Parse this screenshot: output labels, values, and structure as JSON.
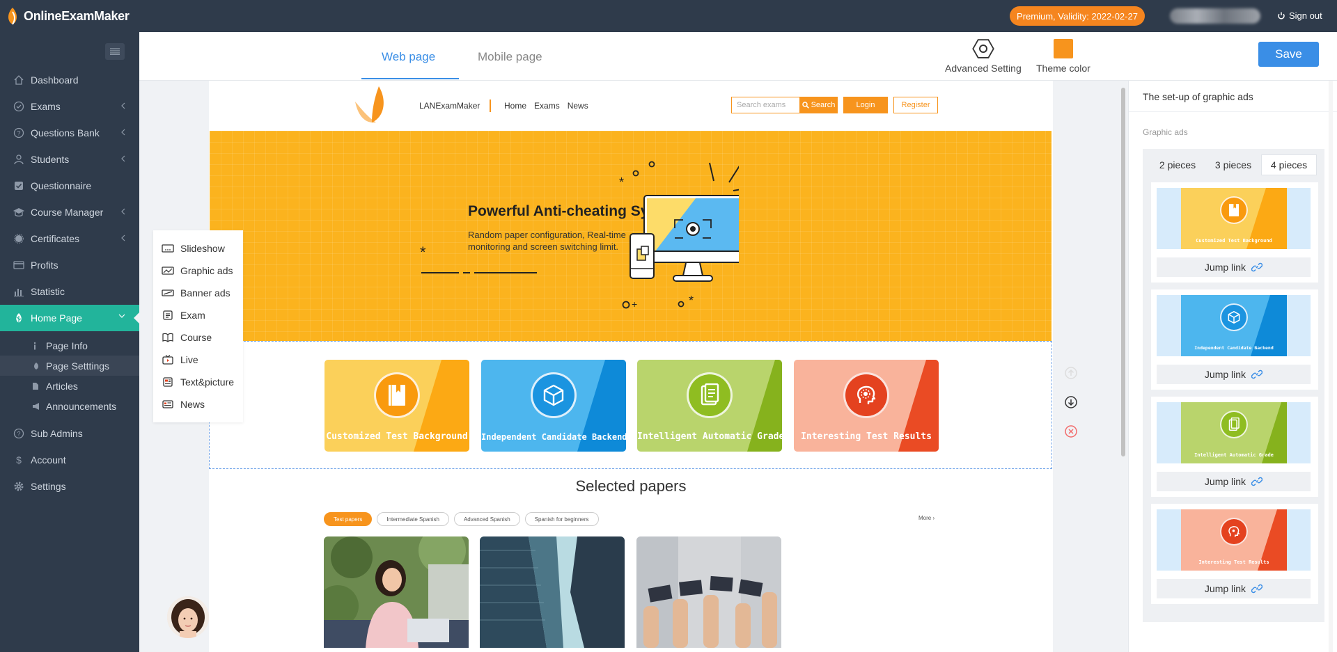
{
  "topbar": {
    "logo_text": "OnlineExamMaker",
    "premium": "Premium, Validity: 2022-02-27",
    "signout": "Sign out",
    "colors": {
      "bg": "#2f3b4b",
      "premium": "#f5851f"
    }
  },
  "sidebar": {
    "items": [
      {
        "label": "Dashboard",
        "icon": "home-icon"
      },
      {
        "label": "Exams",
        "icon": "check-circle-icon",
        "has_children": true
      },
      {
        "label": "Questions Bank",
        "icon": "question-icon",
        "has_children": true
      },
      {
        "label": "Students",
        "icon": "user-icon",
        "has_children": true
      },
      {
        "label": "Questionnaire",
        "icon": "checkbox-icon"
      },
      {
        "label": "Course Manager",
        "icon": "graduation-cap-icon",
        "has_children": true
      },
      {
        "label": "Certificates",
        "icon": "badge-icon",
        "has_children": true
      },
      {
        "label": "Profits",
        "icon": "card-icon"
      },
      {
        "label": "Statistic",
        "icon": "bar-chart-icon"
      },
      {
        "label": "Home Page",
        "icon": "leaf-icon",
        "active": true,
        "expanded": true
      }
    ],
    "subitems": [
      {
        "label": "Page Info",
        "icon": "info-icon"
      },
      {
        "label": "Page Setttings",
        "icon": "leaf-icon",
        "active": true
      },
      {
        "label": "Articles",
        "icon": "file-icon"
      },
      {
        "label": "Announcements",
        "icon": "megaphone-icon"
      }
    ],
    "items_bottom": [
      {
        "label": "Sub Admins",
        "icon": "question-icon"
      },
      {
        "label": "Account",
        "icon": "dollar-icon"
      },
      {
        "label": "Settings",
        "icon": "gear-icon"
      }
    ],
    "active_color": "#22b49b"
  },
  "header": {
    "tabs": [
      {
        "label": "Web page",
        "active": true
      },
      {
        "label": "Mobile page"
      }
    ],
    "advanced_setting": "Advanced Setting",
    "theme_color": "Theme color",
    "theme_swatch": "#f7941d",
    "save": "Save"
  },
  "component_menu": {
    "items": [
      {
        "label": "Slideshow",
        "icon": "slideshow-icon"
      },
      {
        "label": "Graphic ads",
        "icon": "graphic-ads-icon"
      },
      {
        "label": "Banner ads",
        "icon": "banner-ads-icon"
      },
      {
        "label": "Exam",
        "icon": "exam-icon"
      },
      {
        "label": "Course",
        "icon": "course-icon"
      },
      {
        "label": "Live",
        "icon": "live-icon"
      },
      {
        "label": "Text&picture",
        "icon": "text-picture-icon"
      },
      {
        "label": "News",
        "icon": "news-icon"
      }
    ]
  },
  "preview": {
    "brand": "LANExamMaker",
    "nav": [
      "Home",
      "Exams",
      "News"
    ],
    "search_placeholder": "Search exams",
    "search_button": "Search",
    "login": "Login",
    "register": "Register",
    "banner": {
      "title": "Powerful Anti-cheating System",
      "subtitle": "Random paper configuration, Real-time monitoring and screen switching limit.",
      "color": "#fbb31e"
    },
    "ads": [
      {
        "label": "Customized Test Background",
        "light": "#fbd05a",
        "dark": "#fca914",
        "icon": "book-icon"
      },
      {
        "label": "Independent Candidate Backend",
        "light": "#4db6ee",
        "dark": "#0e8ad8",
        "icon": "cube-icon"
      },
      {
        "label": "Intelligent Automatic Grade",
        "light": "#b9d46c",
        "dark": "#86b21d",
        "icon": "document-icon"
      },
      {
        "label": "Interesting Test Results",
        "light": "#f9b39b",
        "dark": "#ea4b24",
        "icon": "brain-icon"
      }
    ],
    "papers_title": "Selected papers",
    "chips": [
      {
        "label": "Test papers",
        "active": true
      },
      {
        "label": "Intermediate Spanish"
      },
      {
        "label": "Advanced Spanish"
      },
      {
        "label": "Spanish for beginners"
      }
    ],
    "more": "More"
  },
  "right_panel": {
    "title": "The set-up of graphic ads",
    "label": "Graphic ads",
    "pieces": [
      {
        "label": "2 pieces"
      },
      {
        "label": "3 pieces"
      },
      {
        "label": "4 pieces",
        "active": true
      }
    ],
    "jump_link": "Jump link"
  }
}
